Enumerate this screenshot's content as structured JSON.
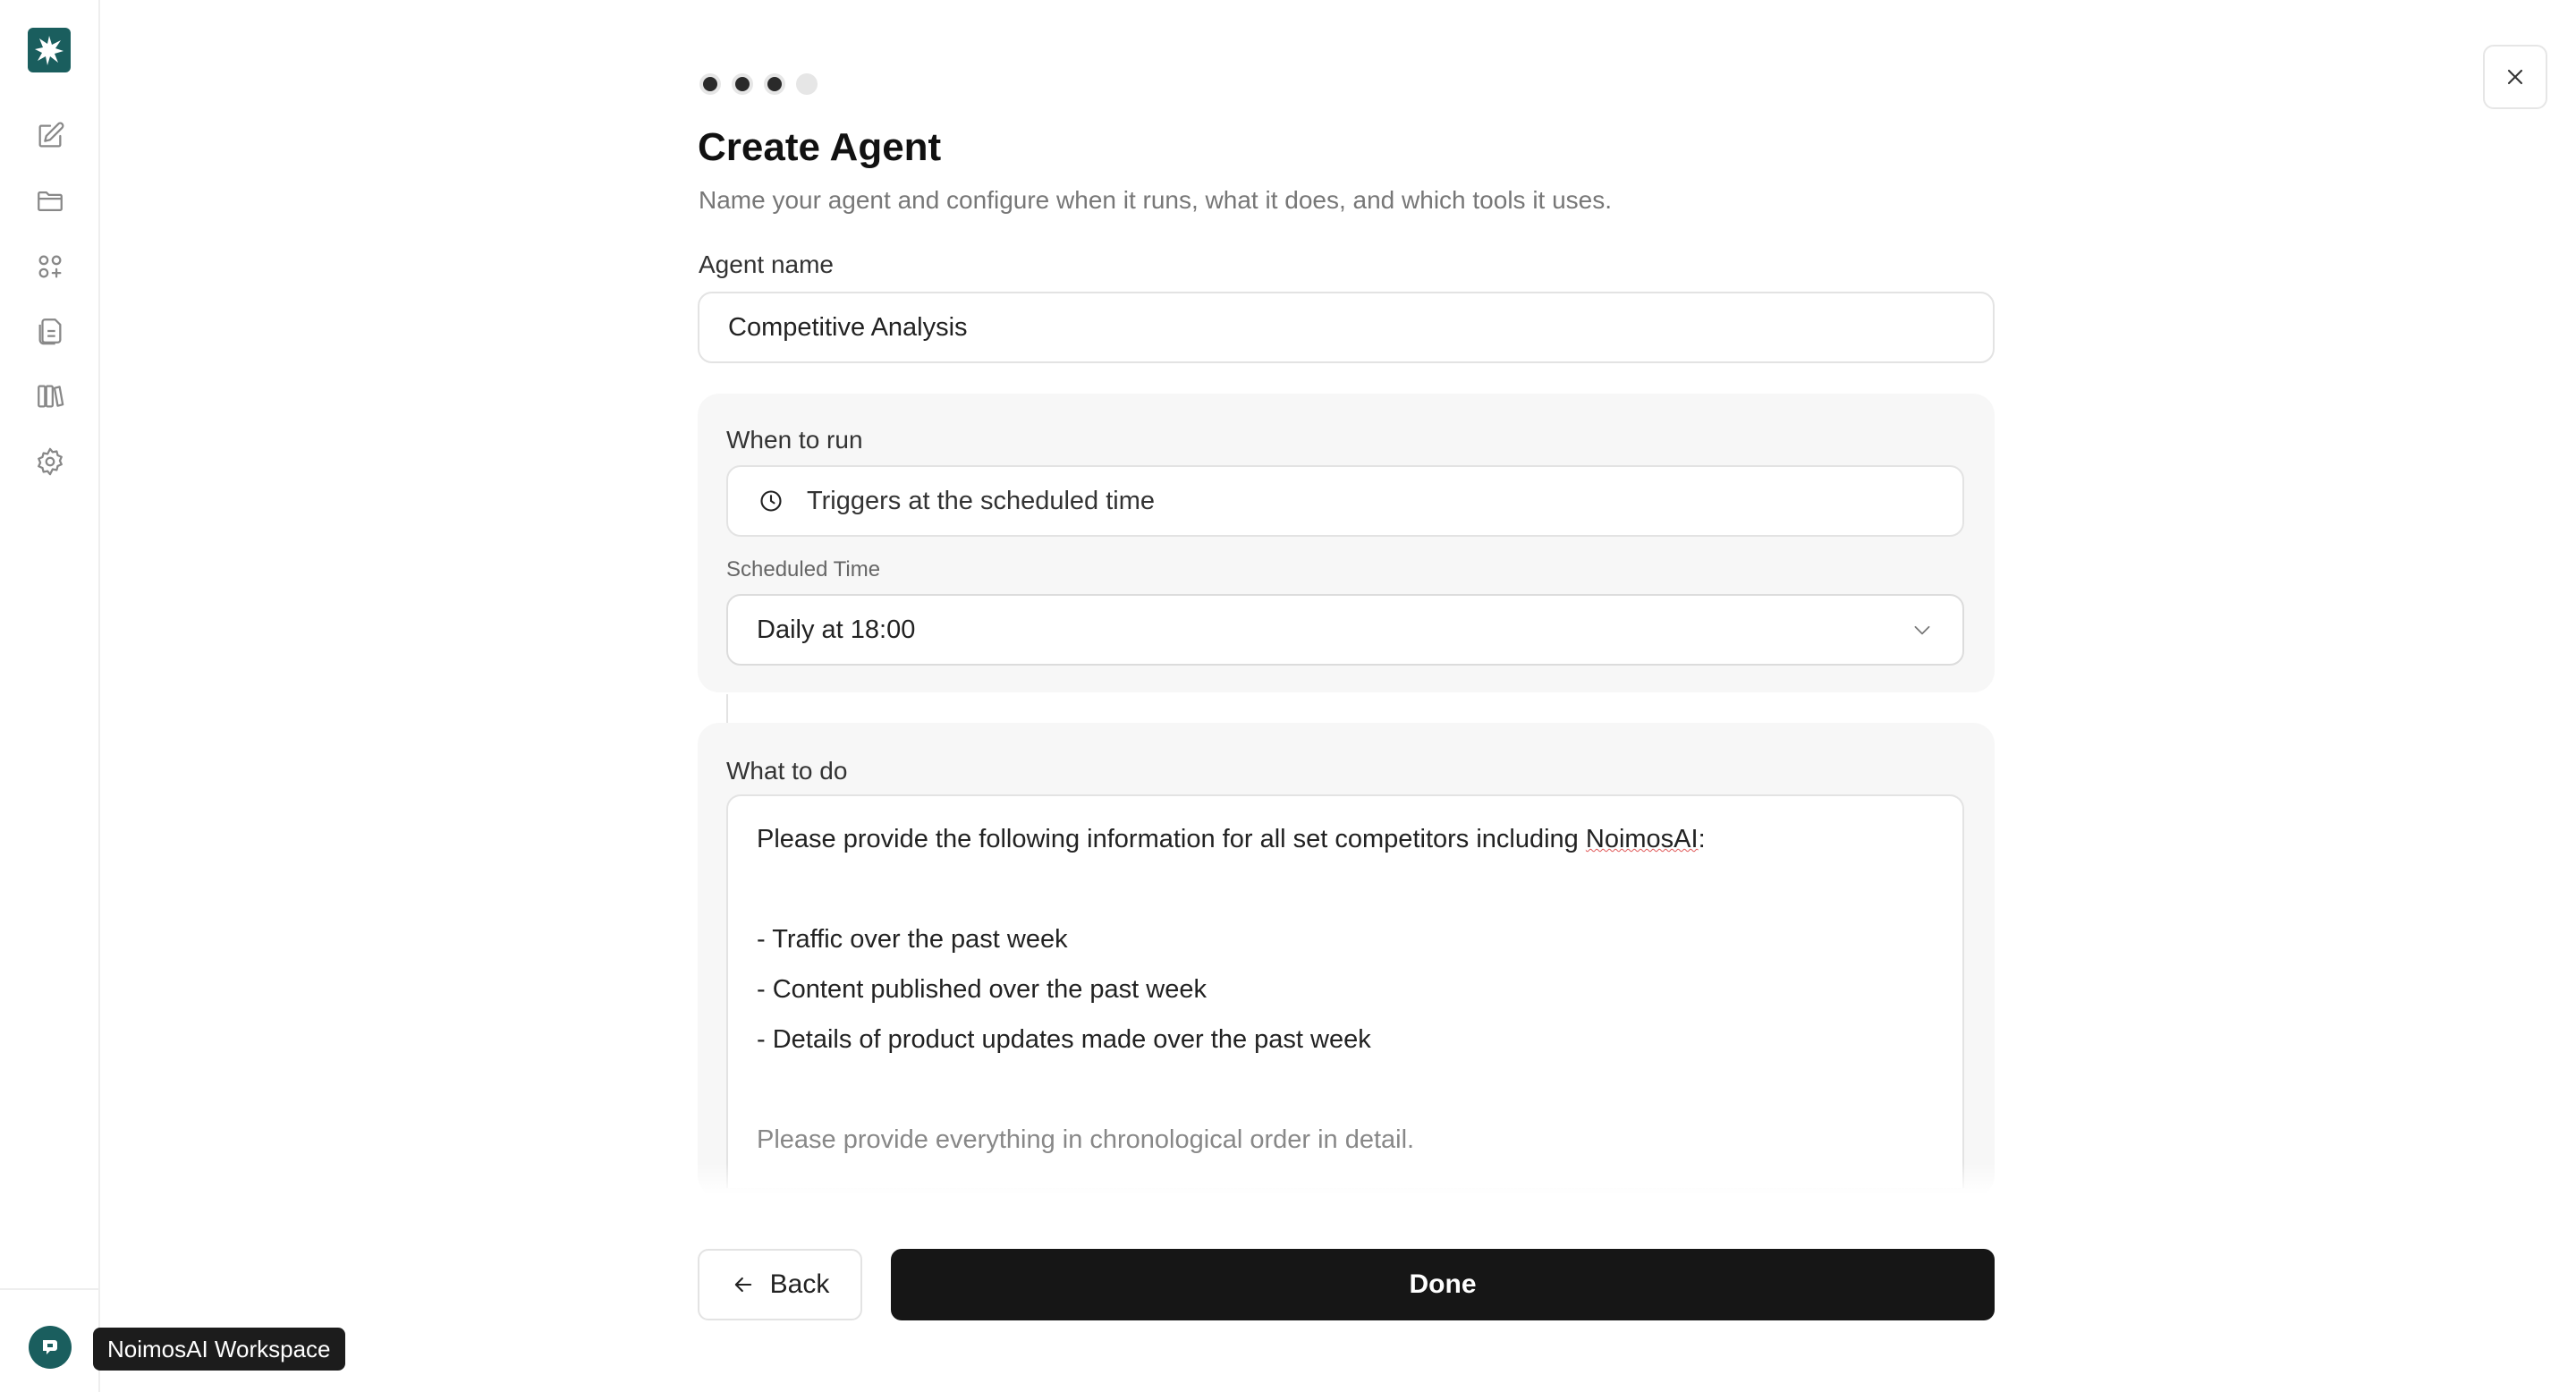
{
  "sidebar": {
    "logo_icon": "starburst-logo-icon",
    "items": [
      {
        "name": "new-chat",
        "icon": "edit-icon"
      },
      {
        "name": "folders",
        "icon": "folder-icon"
      },
      {
        "name": "apps",
        "icon": "apps-icon"
      },
      {
        "name": "documents",
        "icon": "document-icon"
      },
      {
        "name": "library",
        "icon": "library-icon"
      },
      {
        "name": "settings",
        "icon": "gear-icon"
      }
    ],
    "workspace_tooltip": "NoimosAI Workspace"
  },
  "steps": {
    "total": 4,
    "completed": 3
  },
  "header": {
    "title": "Create Agent",
    "subtitle": "Name your agent and configure when it runs, what it does, and which tools it uses."
  },
  "agent_name": {
    "label": "Agent name",
    "value": "Competitive Analysis"
  },
  "when_to_run": {
    "label": "When to run",
    "trigger": "Triggers at the scheduled time",
    "scheduled_label": "Scheduled Time",
    "scheduled_value": "Daily at 18:00"
  },
  "what_to_do": {
    "label": "What to do",
    "line1_prefix": "Please provide the following information for all set competitors including ",
    "line1_brand": "NoimosAI",
    "line1_suffix": ":",
    "bullet1": "- Traffic over the past week",
    "bullet2": "- Content published over the past week",
    "bullet3": "- Details of product updates made over the past week",
    "closing": "Please provide everything in chronological order in detail."
  },
  "footer": {
    "back_label": "Back",
    "done_label": "Done"
  },
  "colors": {
    "brand": "#1a5e5e",
    "primary_button": "#161616"
  }
}
